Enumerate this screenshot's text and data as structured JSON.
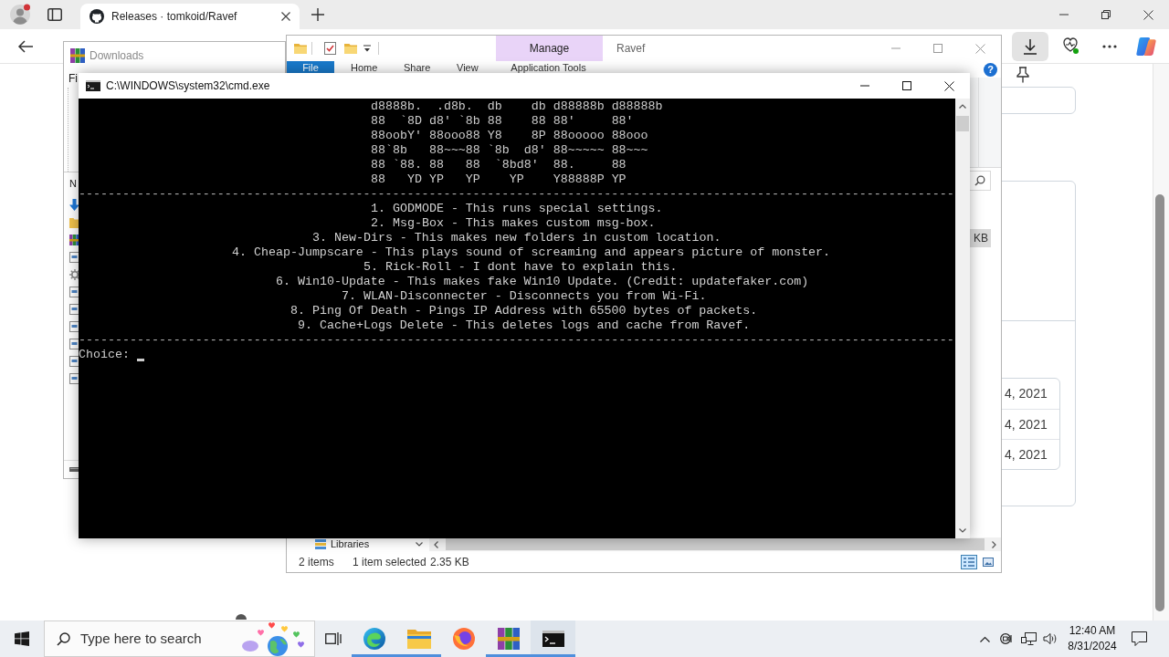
{
  "browser": {
    "tabs": [
      {
        "title": "Releases · tomkoid/Ravef",
        "selected": true
      }
    ],
    "page": {
      "dates": [
        "4, 2021",
        "4, 2021",
        "4, 2021"
      ]
    }
  },
  "downloads_window": {
    "title": "Downloads",
    "menu": [
      "Fi"
    ],
    "columns": [
      "N"
    ],
    "files": [
      {
        "kind": "download"
      },
      {
        "kind": "folder"
      },
      {
        "kind": "archive"
      },
      {
        "kind": "document"
      },
      {
        "kind": "settings"
      },
      {
        "kind": "document"
      },
      {
        "kind": "document"
      },
      {
        "kind": "document"
      },
      {
        "kind": "document"
      },
      {
        "kind": "document"
      },
      {
        "kind": "document"
      }
    ]
  },
  "explorer_window": {
    "context_tab": "Manage",
    "title": "Ravef",
    "ribbon_tabs": [
      {
        "label": "File",
        "kind": "file_menu"
      },
      {
        "label": "Home",
        "kind": "tab"
      },
      {
        "label": "Share",
        "kind": "tab"
      },
      {
        "label": "View",
        "kind": "tab"
      },
      {
        "label": "Application Tools",
        "kind": "context"
      }
    ],
    "help": "?",
    "files": [
      {
        "size": "KB",
        "selected": true
      }
    ],
    "navigation": [
      {
        "label": "Libraries"
      }
    ],
    "status_bar": {
      "item_count": "2 items",
      "selection": "1 item selected",
      "selection_size": "2.35 KB"
    },
    "views": [
      {
        "kind": "details",
        "selected": true
      },
      {
        "kind": "large_icons",
        "selected": false
      }
    ]
  },
  "console_window": {
    "title": "C:\\WINDOWS\\system32\\cmd.exe",
    "banner": [
      "d8888b.  .d8b.  db    db d88888b d88888b",
      "88  `8D d8' `8b 88    88 88'     88'",
      "88oobY' 88ooo88 Y8    8P 88ooooo 88ooo",
      "88`8b   88~~~88 `8b  d8' 88~~~~~ 88~~~",
      "88 `88. 88   88  `8bd8'  88.     88",
      "88   YD YP   YP    YP    Y88888P YP"
    ],
    "lines": [
      {
        "kind": "divider",
        "text": "------------------------------------------------------------------------------------------------------------------------"
      },
      {
        "kind": "option",
        "text": "1. GODMODE - This runs special settings."
      },
      {
        "kind": "option",
        "text": "2. Msg-Box - This makes custom msg-box."
      },
      {
        "kind": "option",
        "text": "3. New-Dirs - This makes new folders in custom location."
      },
      {
        "kind": "option",
        "text": "4. Cheap-Jumpscare - This plays sound of screaming and appears picture of monster."
      },
      {
        "kind": "option",
        "text": "5. Rick-Roll - I dont have to explain this."
      },
      {
        "kind": "option",
        "text": "6. Win10-Update - This makes fake Win10 Update. (Credit: updatefaker.com)"
      },
      {
        "kind": "option",
        "text": "7. WLAN-Disconnecter - Disconnects you from Wi-Fi."
      },
      {
        "kind": "option",
        "text": "8. Ping Of Death - Pings IP Address with 65500 bytes of packets."
      },
      {
        "kind": "option",
        "text": "9. Cache+Logs Delete - This deletes logs and cache from Ravef."
      },
      {
        "kind": "divider",
        "text": "------------------------------------------------------------------------------------------------------------------------"
      }
    ],
    "prompt": "Choice:"
  },
  "taskbar": {
    "search": {
      "placeholder": "Type here to search"
    },
    "apps": [
      {
        "kind": "browser",
        "running": true,
        "selected": false
      },
      {
        "kind": "file_explorer",
        "running": true,
        "selected": false
      },
      {
        "kind": "firefox",
        "running": false,
        "selected": false
      },
      {
        "kind": "archiver",
        "running": true,
        "selected": false
      },
      {
        "kind": "terminal",
        "running": true,
        "selected": true
      }
    ],
    "clock": {
      "time": "12:40 AM",
      "date": "8/31/2024"
    }
  }
}
